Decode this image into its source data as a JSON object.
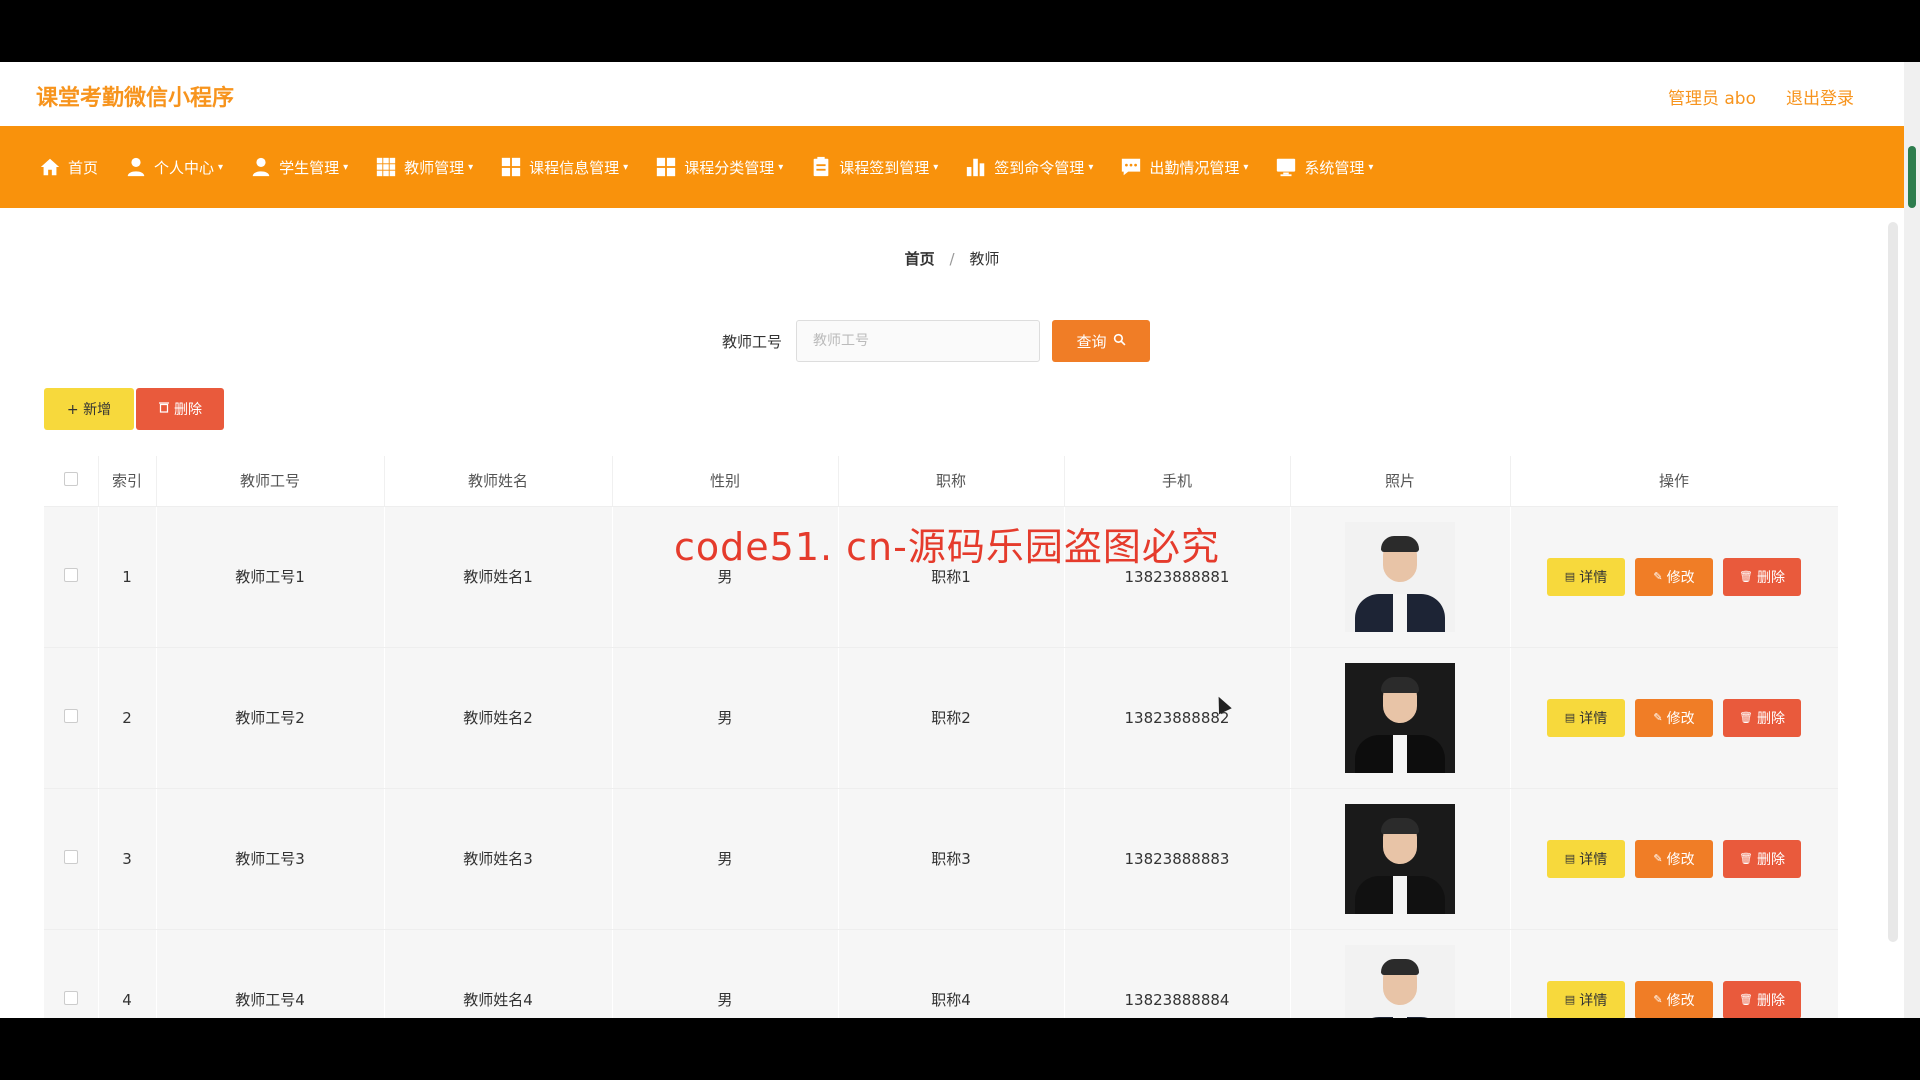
{
  "app": {
    "title": "课堂考勤微信小程序"
  },
  "header": {
    "user_label": "管理员 abo",
    "logout_label": "退出登录"
  },
  "nav": {
    "items": [
      {
        "label": "首页",
        "icon": "home-icon",
        "dropdown": false
      },
      {
        "label": "个人中心",
        "icon": "user-icon",
        "dropdown": true
      },
      {
        "label": "学生管理",
        "icon": "user-icon",
        "dropdown": true
      },
      {
        "label": "教师管理",
        "icon": "grid-icon",
        "dropdown": true
      },
      {
        "label": "课程信息管理",
        "icon": "grid-icon",
        "dropdown": true
      },
      {
        "label": "课程分类管理",
        "icon": "grid-icon",
        "dropdown": true
      },
      {
        "label": "课程签到管理",
        "icon": "clipboard-icon",
        "dropdown": true
      },
      {
        "label": "签到命令管理",
        "icon": "bar-chart-icon",
        "dropdown": true
      },
      {
        "label": "出勤情况管理",
        "icon": "message-icon",
        "dropdown": true
      },
      {
        "label": "系统管理",
        "icon": "monitor-icon",
        "dropdown": true
      }
    ]
  },
  "breadcrumb": {
    "home": "首页",
    "separator": "/",
    "current": "教师"
  },
  "search": {
    "label": "教师工号",
    "placeholder": "教师工号",
    "value": "",
    "button_label": "查询"
  },
  "actions": {
    "add_label": "+ 新增",
    "batch_delete_label": "删除"
  },
  "table": {
    "headers": [
      "索引",
      "教师工号",
      "教师姓名",
      "性别",
      "职称",
      "手机",
      "照片",
      "操作"
    ],
    "rows": [
      {
        "index": "1",
        "teacher_id": "教师工号1",
        "name": "教师姓名1",
        "gender": "男",
        "title": "职称1",
        "phone": "13823888881",
        "photo": "light"
      },
      {
        "index": "2",
        "teacher_id": "教师工号2",
        "name": "教师姓名2",
        "gender": "男",
        "title": "职称2",
        "phone": "13823888882",
        "photo": "dark"
      },
      {
        "index": "3",
        "teacher_id": "教师工号3",
        "name": "教师姓名3",
        "gender": "男",
        "title": "职称3",
        "phone": "13823888883",
        "photo": "dark"
      },
      {
        "index": "4",
        "teacher_id": "教师工号4",
        "name": "教师姓名4",
        "gender": "男",
        "title": "职称4",
        "phone": "13823888884",
        "photo": "light"
      }
    ],
    "op_labels": {
      "detail": "详情",
      "edit": "修改",
      "delete": "删除"
    }
  },
  "watermark": {
    "banner": "code51. cn-源码乐园盗图必究"
  },
  "colors": {
    "accent": "#f9920c",
    "title": "#f7941d",
    "yellow": "#f7d93c",
    "orange": "#f07d26",
    "red": "#e95a3c",
    "banner_red": "#e53b2c"
  }
}
